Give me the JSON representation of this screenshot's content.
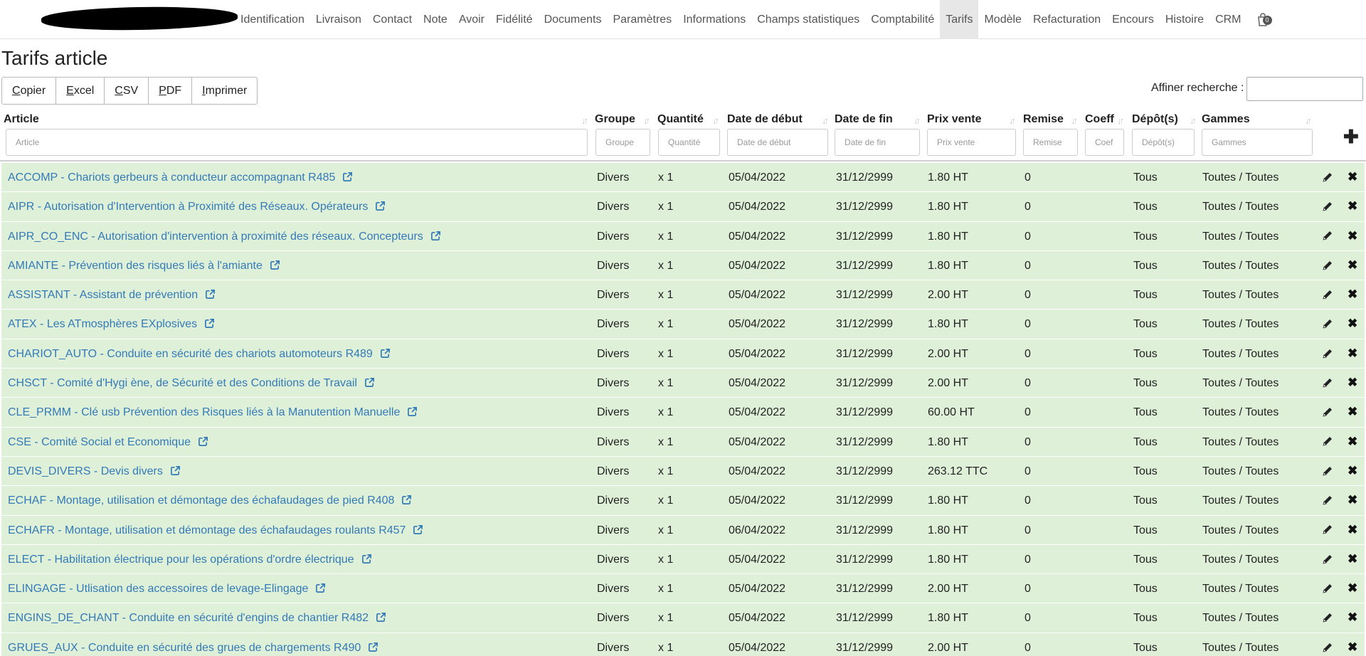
{
  "nav": {
    "items": [
      "Identification",
      "Livraison",
      "Contact",
      "Note",
      "Avoir",
      "Fidélité",
      "Documents",
      "Paramètres",
      "Informations",
      "Champs statistiques",
      "Comptabilité",
      "Tarifs",
      "Modèle",
      "Refacturation",
      "Encours",
      "Histoire",
      "CRM"
    ],
    "active": "Tarifs",
    "bag_icon": "shopping-bag-icon",
    "bag_count": "0"
  },
  "page": {
    "title": "Tarifs article"
  },
  "export": {
    "buttons": [
      "Copier",
      "Excel",
      "CSV",
      "PDF",
      "Imprimer"
    ]
  },
  "search": {
    "label": "Affiner recherche :",
    "value": ""
  },
  "table": {
    "columns": [
      "Article",
      "Groupe",
      "Quantité",
      "Date de début",
      "Date de fin",
      "Prix vente",
      "Remise",
      "Coeff",
      "Dépôt(s)",
      "Gammes"
    ],
    "filter_placeholders": [
      "Article",
      "Groupe",
      "Quantité",
      "Date de début",
      "Date de fin",
      "Prix vente",
      "Remise",
      "Coef",
      "Dépôt(s)",
      "Gammes"
    ],
    "row_color": "#dff0d8",
    "link_color": "#337ab7",
    "rows": [
      {
        "article": "ACCOMP - Chariots gerbeurs à conducteur accompagnant R485",
        "groupe": "Divers",
        "quantite": "x 1",
        "debut": "05/04/2022",
        "fin": "31/12/2999",
        "prix": "1.80 HT",
        "remise": "0",
        "coeff": "",
        "depots": "Tous",
        "gammes": "Toutes / Toutes"
      },
      {
        "article": "AIPR - Autorisation d'Intervention à Proximité des Réseaux. Opérateurs",
        "groupe": "Divers",
        "quantite": "x 1",
        "debut": "05/04/2022",
        "fin": "31/12/2999",
        "prix": "1.80 HT",
        "remise": "0",
        "coeff": "",
        "depots": "Tous",
        "gammes": "Toutes / Toutes"
      },
      {
        "article": "AIPR_CO_ENC - Autorisation d'intervention à proximité des réseaux. Concepteurs",
        "groupe": "Divers",
        "quantite": "x 1",
        "debut": "05/04/2022",
        "fin": "31/12/2999",
        "prix": "1.80 HT",
        "remise": "0",
        "coeff": "",
        "depots": "Tous",
        "gammes": "Toutes / Toutes"
      },
      {
        "article": "AMIANTE - Prévention des risques liés à l'amiante",
        "groupe": "Divers",
        "quantite": "x 1",
        "debut": "05/04/2022",
        "fin": "31/12/2999",
        "prix": "1.80 HT",
        "remise": "0",
        "coeff": "",
        "depots": "Tous",
        "gammes": "Toutes / Toutes"
      },
      {
        "article": "ASSISTANT - Assistant de prévention",
        "groupe": "Divers",
        "quantite": "x 1",
        "debut": "05/04/2022",
        "fin": "31/12/2999",
        "prix": "2.00 HT",
        "remise": "0",
        "coeff": "",
        "depots": "Tous",
        "gammes": "Toutes / Toutes"
      },
      {
        "article": "ATEX - Les ATmosphères EXplosives",
        "groupe": "Divers",
        "quantite": "x 1",
        "debut": "05/04/2022",
        "fin": "31/12/2999",
        "prix": "1.80 HT",
        "remise": "0",
        "coeff": "",
        "depots": "Tous",
        "gammes": "Toutes / Toutes"
      },
      {
        "article": "CHARIOT_AUTO - Conduite en sécurité des chariots automoteurs R489",
        "groupe": "Divers",
        "quantite": "x 1",
        "debut": "05/04/2022",
        "fin": "31/12/2999",
        "prix": "2.00 HT",
        "remise": "0",
        "coeff": "",
        "depots": "Tous",
        "gammes": "Toutes / Toutes"
      },
      {
        "article": "CHSCT - Comité d'Hygi    ène, de Sécurité et des Conditions de Travail",
        "groupe": "Divers",
        "quantite": "x 1",
        "debut": "05/04/2022",
        "fin": "31/12/2999",
        "prix": "2.00 HT",
        "remise": "0",
        "coeff": "",
        "depots": "Tous",
        "gammes": "Toutes / Toutes"
      },
      {
        "article": "CLE_PRMM - Clé usb Prévention des Risques liés à la Manutention Manuelle",
        "groupe": "Divers",
        "quantite": "x 1",
        "debut": "05/04/2022",
        "fin": "31/12/2999",
        "prix": "60.00 HT",
        "remise": "0",
        "coeff": "",
        "depots": "Tous",
        "gammes": "Toutes / Toutes"
      },
      {
        "article": "CSE - Comité Social et Economique",
        "groupe": "Divers",
        "quantite": "x 1",
        "debut": "05/04/2022",
        "fin": "31/12/2999",
        "prix": "1.80 HT",
        "remise": "0",
        "coeff": "",
        "depots": "Tous",
        "gammes": "Toutes / Toutes"
      },
      {
        "article": "DEVIS_DIVERS - Devis divers",
        "groupe": "Divers",
        "quantite": "x 1",
        "debut": "05/04/2022",
        "fin": "31/12/2999",
        "prix": "263.12 TTC",
        "remise": "0",
        "coeff": "",
        "depots": "Tous",
        "gammes": "Toutes / Toutes"
      },
      {
        "article": "ECHAF - Montage, utilisation et démontage des échafaudages de pied R408",
        "groupe": "Divers",
        "quantite": "x 1",
        "debut": "05/04/2022",
        "fin": "31/12/2999",
        "prix": "1.80 HT",
        "remise": "0",
        "coeff": "",
        "depots": "Tous",
        "gammes": "Toutes / Toutes"
      },
      {
        "article": "ECHAFR - Montage, utilisation et démontage des échafaudages roulants R457",
        "groupe": "Divers",
        "quantite": "x 1",
        "debut": "06/04/2022",
        "fin": "31/12/2999",
        "prix": "1.80 HT",
        "remise": "0",
        "coeff": "",
        "depots": "Tous",
        "gammes": "Toutes / Toutes"
      },
      {
        "article": "ELECT - Habilitation électrique pour les opérations d'ordre électrique",
        "groupe": "Divers",
        "quantite": "x 1",
        "debut": "05/04/2022",
        "fin": "31/12/2999",
        "prix": "1.80 HT",
        "remise": "0",
        "coeff": "",
        "depots": "Tous",
        "gammes": "Toutes / Toutes"
      },
      {
        "article": "ELINGAGE - Utlisation des accessoires de levage-Elingage",
        "groupe": "Divers",
        "quantite": "x 1",
        "debut": "05/04/2022",
        "fin": "31/12/2999",
        "prix": "2.00 HT",
        "remise": "0",
        "coeff": "",
        "depots": "Tous",
        "gammes": "Toutes / Toutes"
      },
      {
        "article": "ENGINS_DE_CHANT - Conduite en sécurité d'engins de chantier R482",
        "groupe": "Divers",
        "quantite": "x 1",
        "debut": "05/04/2022",
        "fin": "31/12/2999",
        "prix": "1.80 HT",
        "remise": "0",
        "coeff": "",
        "depots": "Tous",
        "gammes": "Toutes / Toutes"
      },
      {
        "article": "GRUES_AUX - Conduite en sécurité des grues de chargements R490",
        "groupe": "Divers",
        "quantite": "x 1",
        "debut": "05/04/2022",
        "fin": "31/12/2999",
        "prix": "2.00 HT",
        "remise": "0",
        "coeff": "",
        "depots": "Tous",
        "gammes": "Toutes / Toutes"
      }
    ]
  }
}
